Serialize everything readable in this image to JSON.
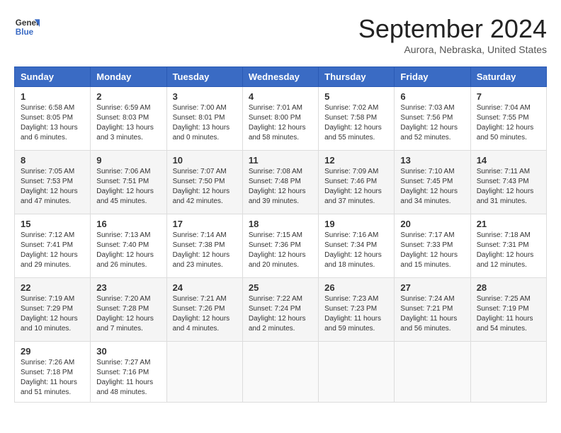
{
  "logo": {
    "line1": "General",
    "line2": "Blue"
  },
  "title": "September 2024",
  "subtitle": "Aurora, Nebraska, United States",
  "days_of_week": [
    "Sunday",
    "Monday",
    "Tuesday",
    "Wednesday",
    "Thursday",
    "Friday",
    "Saturday"
  ],
  "weeks": [
    [
      {
        "day": "1",
        "sunrise": "6:58 AM",
        "sunset": "8:05 PM",
        "daylight": "13 hours and 6 minutes."
      },
      {
        "day": "2",
        "sunrise": "6:59 AM",
        "sunset": "8:03 PM",
        "daylight": "13 hours and 3 minutes."
      },
      {
        "day": "3",
        "sunrise": "7:00 AM",
        "sunset": "8:01 PM",
        "daylight": "13 hours and 0 minutes."
      },
      {
        "day": "4",
        "sunrise": "7:01 AM",
        "sunset": "8:00 PM",
        "daylight": "12 hours and 58 minutes."
      },
      {
        "day": "5",
        "sunrise": "7:02 AM",
        "sunset": "7:58 PM",
        "daylight": "12 hours and 55 minutes."
      },
      {
        "day": "6",
        "sunrise": "7:03 AM",
        "sunset": "7:56 PM",
        "daylight": "12 hours and 52 minutes."
      },
      {
        "day": "7",
        "sunrise": "7:04 AM",
        "sunset": "7:55 PM",
        "daylight": "12 hours and 50 minutes."
      }
    ],
    [
      {
        "day": "8",
        "sunrise": "7:05 AM",
        "sunset": "7:53 PM",
        "daylight": "12 hours and 47 minutes."
      },
      {
        "day": "9",
        "sunrise": "7:06 AM",
        "sunset": "7:51 PM",
        "daylight": "12 hours and 45 minutes."
      },
      {
        "day": "10",
        "sunrise": "7:07 AM",
        "sunset": "7:50 PM",
        "daylight": "12 hours and 42 minutes."
      },
      {
        "day": "11",
        "sunrise": "7:08 AM",
        "sunset": "7:48 PM",
        "daylight": "12 hours and 39 minutes."
      },
      {
        "day": "12",
        "sunrise": "7:09 AM",
        "sunset": "7:46 PM",
        "daylight": "12 hours and 37 minutes."
      },
      {
        "day": "13",
        "sunrise": "7:10 AM",
        "sunset": "7:45 PM",
        "daylight": "12 hours and 34 minutes."
      },
      {
        "day": "14",
        "sunrise": "7:11 AM",
        "sunset": "7:43 PM",
        "daylight": "12 hours and 31 minutes."
      }
    ],
    [
      {
        "day": "15",
        "sunrise": "7:12 AM",
        "sunset": "7:41 PM",
        "daylight": "12 hours and 29 minutes."
      },
      {
        "day": "16",
        "sunrise": "7:13 AM",
        "sunset": "7:40 PM",
        "daylight": "12 hours and 26 minutes."
      },
      {
        "day": "17",
        "sunrise": "7:14 AM",
        "sunset": "7:38 PM",
        "daylight": "12 hours and 23 minutes."
      },
      {
        "day": "18",
        "sunrise": "7:15 AM",
        "sunset": "7:36 PM",
        "daylight": "12 hours and 20 minutes."
      },
      {
        "day": "19",
        "sunrise": "7:16 AM",
        "sunset": "7:34 PM",
        "daylight": "12 hours and 18 minutes."
      },
      {
        "day": "20",
        "sunrise": "7:17 AM",
        "sunset": "7:33 PM",
        "daylight": "12 hours and 15 minutes."
      },
      {
        "day": "21",
        "sunrise": "7:18 AM",
        "sunset": "7:31 PM",
        "daylight": "12 hours and 12 minutes."
      }
    ],
    [
      {
        "day": "22",
        "sunrise": "7:19 AM",
        "sunset": "7:29 PM",
        "daylight": "12 hours and 10 minutes."
      },
      {
        "day": "23",
        "sunrise": "7:20 AM",
        "sunset": "7:28 PM",
        "daylight": "12 hours and 7 minutes."
      },
      {
        "day": "24",
        "sunrise": "7:21 AM",
        "sunset": "7:26 PM",
        "daylight": "12 hours and 4 minutes."
      },
      {
        "day": "25",
        "sunrise": "7:22 AM",
        "sunset": "7:24 PM",
        "daylight": "12 hours and 2 minutes."
      },
      {
        "day": "26",
        "sunrise": "7:23 AM",
        "sunset": "7:23 PM",
        "daylight": "11 hours and 59 minutes."
      },
      {
        "day": "27",
        "sunrise": "7:24 AM",
        "sunset": "7:21 PM",
        "daylight": "11 hours and 56 minutes."
      },
      {
        "day": "28",
        "sunrise": "7:25 AM",
        "sunset": "7:19 PM",
        "daylight": "11 hours and 54 minutes."
      }
    ],
    [
      {
        "day": "29",
        "sunrise": "7:26 AM",
        "sunset": "7:18 PM",
        "daylight": "11 hours and 51 minutes."
      },
      {
        "day": "30",
        "sunrise": "7:27 AM",
        "sunset": "7:16 PM",
        "daylight": "11 hours and 48 minutes."
      },
      null,
      null,
      null,
      null,
      null
    ]
  ],
  "labels": {
    "sunrise": "Sunrise:",
    "sunset": "Sunset:",
    "daylight": "Daylight:"
  }
}
